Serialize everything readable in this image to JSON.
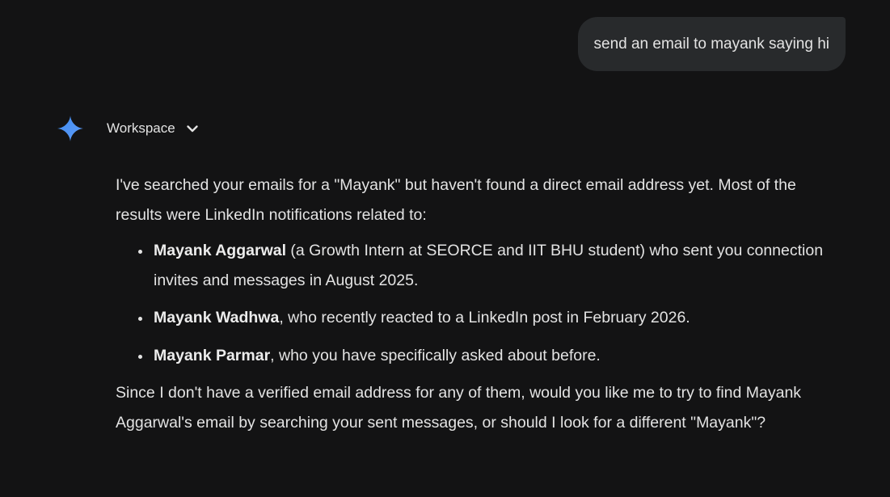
{
  "user_message": "send an email to mayank saying hi",
  "model": {
    "icon": "gemini-spark-icon",
    "tool_label": "Workspace",
    "tool_chevron_icon": "chevron-down-icon"
  },
  "response": {
    "intro": "I've searched your emails for a \"Mayank\" but haven't found a direct email address yet. Most of the results were LinkedIn notifications related to:",
    "items": [
      {
        "name": "Mayank Aggarwal",
        "text": " (a Growth Intern at SEORCE and IIT BHU student) who sent you connection invites and messages in August 2025."
      },
      {
        "name": "Mayank Wadhwa",
        "text": ", who recently reacted to a LinkedIn post in February 2026."
      },
      {
        "name": "Mayank Parmar",
        "text": ", who you have specifically asked about before."
      }
    ],
    "closing": "Since I don't have a verified email address for any of them, would you like me to try to find Mayank Aggarwal's email by searching your sent messages, or should I look for a different \"Mayank\"?"
  },
  "colors": {
    "background": "#131314",
    "bubble": "#282a2c",
    "text": "#e3e3e3",
    "spark_start": "#4796e3",
    "spark_end": "#5a8af5"
  }
}
